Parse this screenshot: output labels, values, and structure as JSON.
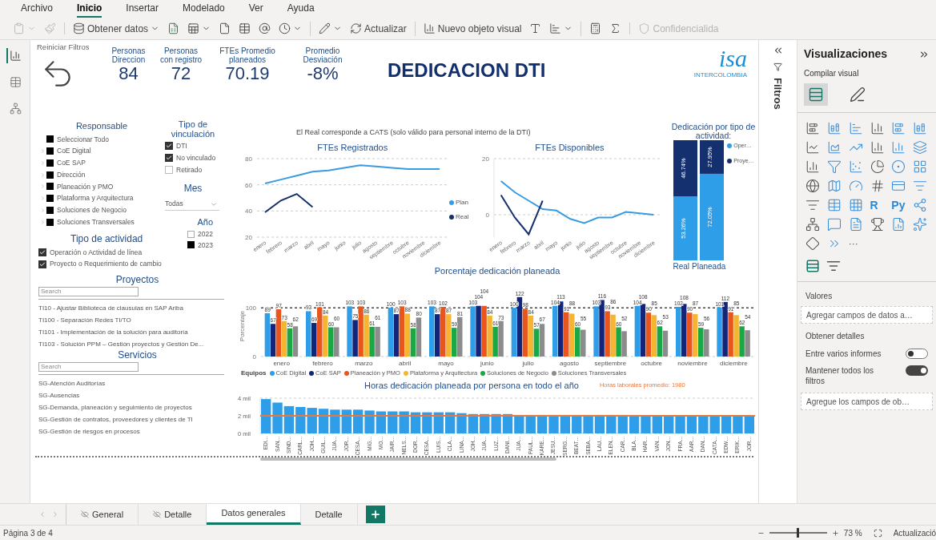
{
  "menu_bar": {
    "tabs": [
      {
        "label": "Archivo",
        "selected": false
      },
      {
        "label": "Inicio",
        "selected": true
      },
      {
        "label": "Insertar",
        "selected": false
      },
      {
        "label": "Modelado",
        "selected": false
      },
      {
        "label": "Ver",
        "selected": false
      },
      {
        "label": "Ayuda",
        "selected": false
      }
    ]
  },
  "ribbon": {
    "groups": [
      [
        {
          "dropdown": true,
          "disabled": true
        },
        {
          "dropdown": false,
          "disabled": true
        }
      ],
      [
        {
          "label": "Obtener datos",
          "dropdown": true,
          "disabled": false
        },
        {
          "dropdown": false,
          "disabled": false
        },
        {
          "dropdown": true,
          "disabled": false
        },
        {
          "dropdown": false,
          "disabled": false
        },
        {
          "dropdown": false,
          "disabled": false
        },
        {
          "dropdown": false,
          "disabled": false
        },
        {
          "dropdown": true,
          "disabled": false
        }
      ],
      [
        {
          "dropdown": true,
          "disabled": false
        },
        {
          "label": "Actualizar",
          "dropdown": false,
          "disabled": false
        }
      ],
      [
        {
          "label": "Nuevo objeto visual",
          "dropdown": false,
          "disabled": false
        },
        {
          "dropdown": false,
          "disabled": false
        },
        {
          "dropdown": true,
          "disabled": false
        }
      ],
      [
        {
          "dropdown": false,
          "disabled": false
        },
        {
          "dropdown": false,
          "disabled": false
        }
      ],
      [
        {
          "label": "Confidencialida",
          "dropdown": false,
          "disabled": true
        }
      ]
    ]
  },
  "view_rail": {
    "items": [
      {
        "selected": true
      },
      {
        "selected": false
      },
      {
        "selected": false
      }
    ]
  },
  "report": {
    "reset": {
      "label": "Reiniciar Filtros"
    },
    "kpis": [
      {
        "label": "Personas Direccion",
        "value": "84"
      },
      {
        "label": "Personas con registro",
        "value": "72"
      },
      {
        "label": "FTEs Promedio planeados",
        "value": "70.19"
      },
      {
        "label": "Promedio Desviación",
        "value": "-8%"
      }
    ],
    "title": "DEDICACION DTI",
    "logo": {
      "mark": "isa",
      "subtitle": "INTERCOLOMBIA"
    },
    "slicers": {
      "responsable": {
        "title": "Responsable",
        "kind": "square",
        "items": [
          {
            "label": "Seleccionar Todo",
            "checked": true,
            "kind": "all"
          },
          {
            "label": "CoE Digital",
            "checked": true,
            "kind": "group"
          },
          {
            "label": "CoE SAP",
            "checked": true,
            "kind": "group"
          },
          {
            "label": "Dirección",
            "checked": true,
            "kind": "group"
          },
          {
            "label": "Planeación y PMO",
            "checked": true,
            "kind": "group"
          },
          {
            "label": "Plataforma y Arquitectura",
            "checked": true,
            "kind": "group"
          },
          {
            "label": "Soluciones de Negocio",
            "checked": true,
            "kind": "group"
          },
          {
            "label": "Soluciones Transversales",
            "checked": true,
            "kind": "group"
          }
        ]
      },
      "vinculacion": {
        "title": "Tipo de vinculación",
        "kind": "tick",
        "items": [
          {
            "label": "DTI",
            "checked": true
          },
          {
            "label": "No vinculado",
            "checked": true
          },
          {
            "label": "Retirado",
            "checked": false
          }
        ]
      },
      "mes": {
        "title": "Mes",
        "value": "Todas"
      },
      "anio": {
        "title": "Año",
        "kind": "square",
        "items": [
          {
            "label": "2022",
            "checked": false
          },
          {
            "label": "2023",
            "checked": true
          }
        ]
      },
      "actividad": {
        "title": "Tipo de actividad",
        "kind": "tick",
        "items": [
          {
            "label": "Operación o Actividad de línea",
            "checked": true
          },
          {
            "label": "Proyecto o Requerimiento de cambio",
            "checked": true
          }
        ]
      },
      "proyectos": {
        "title": "Proyectos",
        "placeholder": "Search",
        "items": [
          "TI10 - Ajustar Biblioteca de clausulas en SAP Ariba",
          "TI100 - Separación Redes TI/TO",
          "TI101 - Implementación de la solución para auditoría",
          "TI103 - Solución PPM – Gestión proyectos y Gestión De..."
        ]
      },
      "servicios": {
        "title": "Servicios",
        "placeholder": "Search",
        "items": [
          "SG-Atención Auditorías",
          "SG-Ausencias",
          "SG-Demanda, planeación y seguimiento de proyectos",
          "SG-Gestión de contratos, proveedores y clientes de TI",
          "SG-Gestión de riesgos en procesos"
        ]
      }
    },
    "note": "El Real corresponde a CATS (solo válido para personal interno de la DTI)",
    "fte_registrados": {
      "chart_data": {
        "type": "line",
        "title": "FTEs Registrados",
        "categories": [
          "enero",
          "febrero",
          "marzo",
          "abril",
          "mayo",
          "junio",
          "julio",
          "agosto",
          "septiembre",
          "octubre",
          "noviembre",
          "diciembre"
        ],
        "ylim": [
          20,
          80
        ],
        "yticks": [
          20,
          40,
          60,
          80
        ],
        "legend": true,
        "series": [
          {
            "name": "Plan",
            "color": "#3a9be0",
            "values": [
              61,
              64,
              67,
              70,
              71,
              73,
              75,
              74,
              73,
              72,
              72,
              72
            ]
          },
          {
            "name": "Real",
            "color": "#15306e",
            "values": [
              39,
              48,
              53,
              43,
              null,
              null,
              null,
              null,
              null,
              null,
              null,
              null
            ]
          }
        ]
      }
    },
    "fte_disponibles": {
      "chart_data": {
        "type": "line",
        "title": "FTEs Disponibles",
        "categories": [
          "enero",
          "febrero",
          "marzo",
          "abril",
          "mayo",
          "junio",
          "julio",
          "agosto",
          "septiembre",
          "octubre",
          "noviembre",
          "diciembre"
        ],
        "ylim": [
          -8,
          20
        ],
        "yticks": [
          0,
          20
        ],
        "series": [
          {
            "color": "#3a9be0",
            "values": [
              12,
              8,
              5,
              2,
              1.5,
              -1.5,
              -3,
              -1,
              -1,
              1,
              0.5,
              0
            ]
          },
          {
            "color": "#15306e",
            "values": [
              7,
              -1,
              -7,
              5,
              null,
              null,
              null,
              null,
              null,
              null,
              null,
              null
            ]
          }
        ]
      }
    },
    "dedicacion_tipo": {
      "chart_data": {
        "type": "bar",
        "title": "Dedicación por tipo de actividad:",
        "stacked": true,
        "legend": true,
        "categories": [
          "Real",
          "Planeada"
        ],
        "series": [
          {
            "name": "Oper…",
            "color": "#2e9ee8",
            "values": [
              53.26,
              72.05
            ],
            "value_labels": [
              "53.26%",
              "72.05%"
            ]
          },
          {
            "name": "Proye…",
            "color": "#15306e",
            "values": [
              46.74,
              27.95
            ],
            "value_labels": [
              "46.74%",
              "27.95%"
            ]
          }
        ]
      }
    },
    "porcentaje": {
      "legend_title": "Equipos",
      "chart_data": {
        "type": "bar",
        "title": "Porcentaje dedicación planeada",
        "ylabel": "Porcentaje",
        "data_labels": true,
        "legend": true,
        "categories": [
          "enero",
          "febrero",
          "marzo",
          "abril",
          "mayo",
          "junio",
          "julio",
          "agosto",
          "septiembre",
          "octubre",
          "noviembre",
          "diciembre"
        ],
        "ylim": [
          0,
          125
        ],
        "yticks": [
          0,
          100
        ],
        "series": [
          {
            "name": "CoE Digital",
            "color": "#2e9ee8",
            "values": [
              89,
              93,
              103,
              100,
              103,
              103,
              100,
              104,
              103,
              104,
              102,
              101
            ]
          },
          {
            "name": "CoE SAP",
            "color": "#12257a",
            "values": [
              67,
              69,
              75,
              87,
              87,
              104,
              122,
              113,
              116,
              108,
              108,
              112
            ]
          },
          {
            "name": "Planeación y PMO",
            "color": "#e8561e",
            "values": [
              97,
              101,
              103,
              103,
              102,
              104,
              98,
              91,
              93,
              90,
              90,
              91
            ]
          },
          {
            "name": "Plataforma y Arquitectura",
            "color": "#f5b530",
            "values": [
              73,
              84,
              86,
              88,
              87,
              84,
              84,
              88,
              86,
              85,
              87,
              85
            ]
          },
          {
            "name": "Soluciones de Negocio",
            "color": "#1aa844",
            "values": [
              58,
              60,
              61,
              58,
              59,
              61,
              57,
              60,
              60,
              62,
              59,
              62
            ]
          },
          {
            "name": "Soluciones Transversales",
            "color": "#8c8c8c",
            "values": [
              62,
              60,
              61,
              80,
              81,
              73,
              67,
              55,
              52,
              53,
              56,
              54
            ]
          }
        ]
      }
    },
    "horas": {
      "chart_data": {
        "type": "bar",
        "title": "Horas dedicación planeada por persona en todo el año",
        "categories": [
          "EDI…",
          "SAN…",
          "SIND…",
          "CARL…",
          "JOH…",
          "GUIL…",
          "JUA…",
          "JOR…",
          "CESA…",
          "MIG…",
          "MO…",
          "JAIR…",
          "NELS…",
          "DOR…",
          "CESA…",
          "LUIS…",
          "CLA…",
          "LINA…",
          "JOH…",
          "JUA…",
          "LUZ…",
          "DANI…",
          "JUA…",
          "PAUL…",
          "KARE…",
          "JESU…",
          "SERG…",
          "BEAT…",
          "SEBA…",
          "LAU…",
          "ELEN…",
          "CAR…",
          "BLA…",
          "HAR…",
          "VAN…",
          "JON…",
          "FRA…",
          "AAR…",
          "DAN…",
          "CATA…",
          "EDW…",
          "ERIK…",
          "JOR…"
        ],
        "values": [
          3.9,
          3.5,
          3.1,
          3.0,
          2.9,
          2.8,
          2.7,
          2.7,
          2.7,
          2.6,
          2.5,
          2.5,
          2.5,
          2.4,
          2.4,
          2.4,
          2.4,
          2.3,
          2.2,
          2.2,
          2.2,
          2.2,
          2.1,
          2.1,
          2.1,
          2.1,
          2.1,
          2.1,
          2.1,
          2.1,
          2.1,
          2.1,
          2.1,
          2.0,
          2.0,
          2.0,
          2.0,
          2.0,
          2.0,
          2.0,
          2.0,
          2.0,
          2.0
        ],
        "ylim": [
          0,
          4
        ],
        "yticks": [
          {
            "value": 0,
            "label": "0 mil"
          },
          {
            "value": 2,
            "label": "2 mil"
          },
          {
            "value": 4,
            "label": "4 mil"
          }
        ],
        "ref_lines": [
          {
            "axis": "y",
            "value": 2
          }
        ]
      },
      "reference_note": "Horas laborales promedio: 1980"
    }
  },
  "filters_pane": {
    "title": "Filtros"
  },
  "visualizations_pane": {
    "title": "Visualizaciones",
    "subtitle": "Compilar visual",
    "build_tabs": [
      {
        "selected": true
      },
      {
        "selected": false
      }
    ],
    "gallery_texts": [
      "R",
      "Py"
    ],
    "more": "···",
    "values_label": "Valores",
    "values_placeholder": "Agregar campos de datos a…",
    "drill_through": {
      "title": "Obtener detalles",
      "toggles": [
        {
          "label": "Entre varios informes",
          "on": false
        },
        {
          "label": "Mantener todos los filtros",
          "on": true
        }
      ],
      "placeholder": "Agregue los campos de ob…"
    }
  },
  "page_tabs": [
    {
      "label": "General",
      "hidden": true,
      "selected": false
    },
    {
      "label": "Detalle",
      "hidden": true,
      "selected": false
    },
    {
      "label": "Datos generales",
      "hidden": false,
      "selected": true
    },
    {
      "label": "Detalle",
      "hidden": false,
      "selected": false
    }
  ],
  "status_bar": {
    "page": "Página 3 de 4",
    "zoom": {
      "level": 0.5,
      "reading": "73 %"
    },
    "update": "Actualizació"
  }
}
